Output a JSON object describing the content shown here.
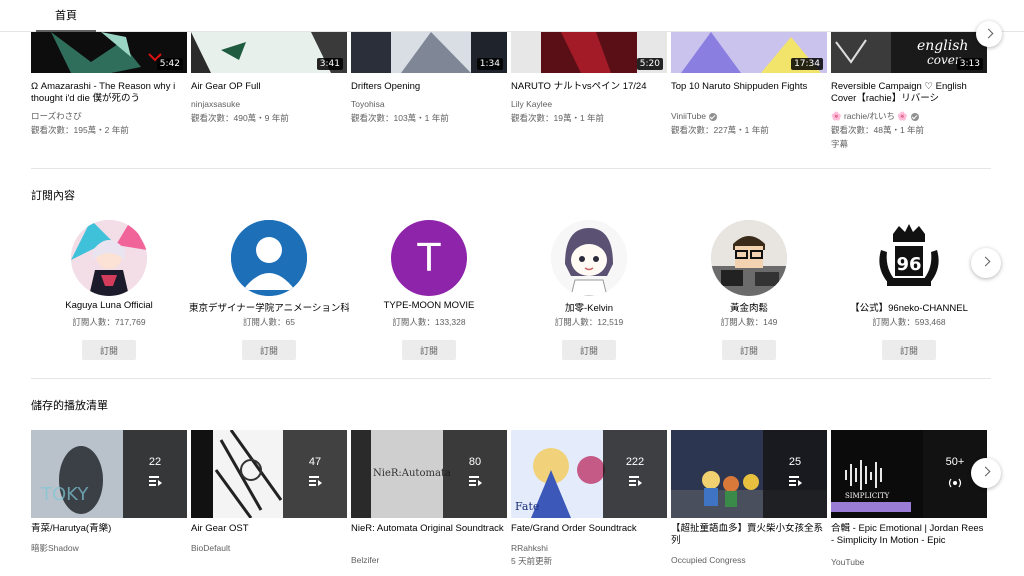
{
  "header": {
    "tab_home": "首頁"
  },
  "videos": [
    {
      "title": "Ω Amazarashi - The Reason why i thought i'd die 僕が死のう",
      "channel": "ローズわさび",
      "verified": false,
      "stats": "觀看次數：195萬・2 年前",
      "extra": "",
      "duration": "5:42"
    },
    {
      "title": "Air Gear OP Full",
      "channel": "ninjaxsasuke",
      "verified": false,
      "stats": "觀看次數：490萬・9 年前",
      "extra": "",
      "duration": "3:41"
    },
    {
      "title": "Drifters Opening",
      "channel": "Toyohisa",
      "verified": false,
      "stats": "觀看次數：103萬・1 年前",
      "extra": "",
      "duration": "1:34"
    },
    {
      "title": "NARUTO ナルトvsペイン 17/24",
      "channel": "Lily Kaylee",
      "verified": false,
      "stats": "觀看次數：19萬・1 年前",
      "extra": "",
      "duration": "5:20"
    },
    {
      "title": "Top 10 Naruto Shippuden Fights",
      "channel": "ViniiTube",
      "verified": true,
      "stats": "觀看次數：227萬・1 年前",
      "extra": "",
      "duration": "17:34"
    },
    {
      "title": "Reversible Campaign ♡ English Cover【rachie】リバーシ",
      "channel": "🌸 rachie/れいち 🌸",
      "verified": true,
      "stats": "觀看次數：48萬・1 年前",
      "extra": "字幕",
      "duration": "3:13"
    }
  ],
  "subscriptions": {
    "title": "訂閱內容",
    "channels": [
      {
        "name": "Kaguya Luna Official",
        "subs": "訂閱人數：717,769",
        "button": "訂閱",
        "avatar": "anime-girl-avatar"
      },
      {
        "name": "東京デザイナー学院アニメーション科",
        "subs": "訂閱人數：65",
        "button": "訂閱",
        "avatar": "default-user-avatar"
      },
      {
        "name": "TYPE-MOON MOVIE",
        "subs": "訂閱人數：133,328",
        "button": "訂閱",
        "avatar": "letter-avatar",
        "letter": "T"
      },
      {
        "name": "加零-Kelvin",
        "subs": "訂閱人數：12,519",
        "button": "訂閱",
        "avatar": "drawn-girl-avatar"
      },
      {
        "name": "黃金肉鬆",
        "subs": "訂閱人數：149",
        "button": "訂閱",
        "avatar": "glasses-man-avatar"
      },
      {
        "name": "【公式】96neko-CHANNEL",
        "subs": "訂閱人數：593,468",
        "button": "訂閱",
        "avatar": "crest-logo-avatar"
      }
    ]
  },
  "playlists": {
    "title": "儲存的播放清單",
    "items": [
      {
        "title": "青菜/Harutya(青樂)",
        "channel": "暗影Shadow",
        "verified": false,
        "extra": "",
        "count": "22"
      },
      {
        "title": "Air Gear OST",
        "channel": "BioDefault",
        "verified": false,
        "extra": "",
        "count": "47"
      },
      {
        "title": "NieR: Automata Original Soundtrack",
        "channel": "Belzifer",
        "verified": false,
        "extra": "",
        "count": "80"
      },
      {
        "title": "Fate/Grand Order Soundtrack",
        "channel": "RRahkshi",
        "verified": false,
        "extra": "5 天前更新",
        "count": "222"
      },
      {
        "title": "【超扯童語血多】賣火柴小女孩全系列",
        "channel": "Occupied Congress",
        "verified": false,
        "extra": "",
        "count": "25"
      },
      {
        "title": "合輯 - Epic Emotional | Jordan Rees - Simplicity In Motion - Epic",
        "channel": "YouTube",
        "verified": false,
        "extra": "",
        "count": "50+"
      }
    ]
  },
  "colors": {
    "text_primary": "#030303",
    "text_secondary": "#606060",
    "button_bg": "#ececec",
    "divider": "#e5e5e5",
    "avatar_blue": "#1d6fb8",
    "avatar_purple": "#8e24aa"
  }
}
